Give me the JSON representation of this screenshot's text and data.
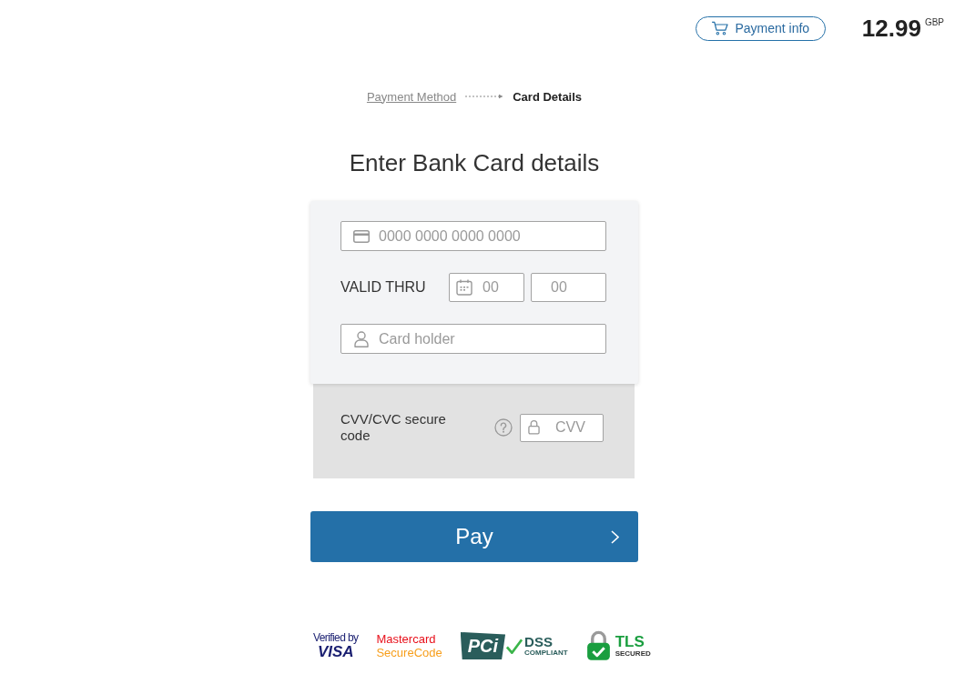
{
  "header": {
    "payment_info_button": "Payment info",
    "amount": "12.99",
    "currency": "GBP"
  },
  "breadcrumb": [
    {
      "label": "Payment Method",
      "selected": false
    },
    {
      "label": "Card Details",
      "selected": true
    }
  ],
  "title": "Enter Bank Card details",
  "card_form": {
    "card_number": {
      "placeholder": "0000 0000 0000 0000"
    },
    "valid_thru": {
      "label": "VALID THRU",
      "month": {
        "placeholder": "00"
      },
      "year": {
        "placeholder": "00"
      }
    },
    "card_holder": {
      "placeholder": "Card holder"
    }
  },
  "cvv": {
    "label": "CVV/CVC secure code",
    "field": {
      "placeholder": "CVV"
    }
  },
  "pay_button": {
    "label": "Pay"
  },
  "badges": [
    {
      "kind": "visa",
      "lines": [
        "Verified by",
        "VISA"
      ]
    },
    {
      "kind": "mastercard",
      "lines": [
        "Mastercard",
        "SecureCode"
      ]
    },
    {
      "kind": "pci",
      "lines": [
        "PCi",
        "DSS",
        "COMPLIANT"
      ]
    },
    {
      "kind": "tls",
      "lines": [
        "TLS",
        "SECURED"
      ]
    }
  ]
}
